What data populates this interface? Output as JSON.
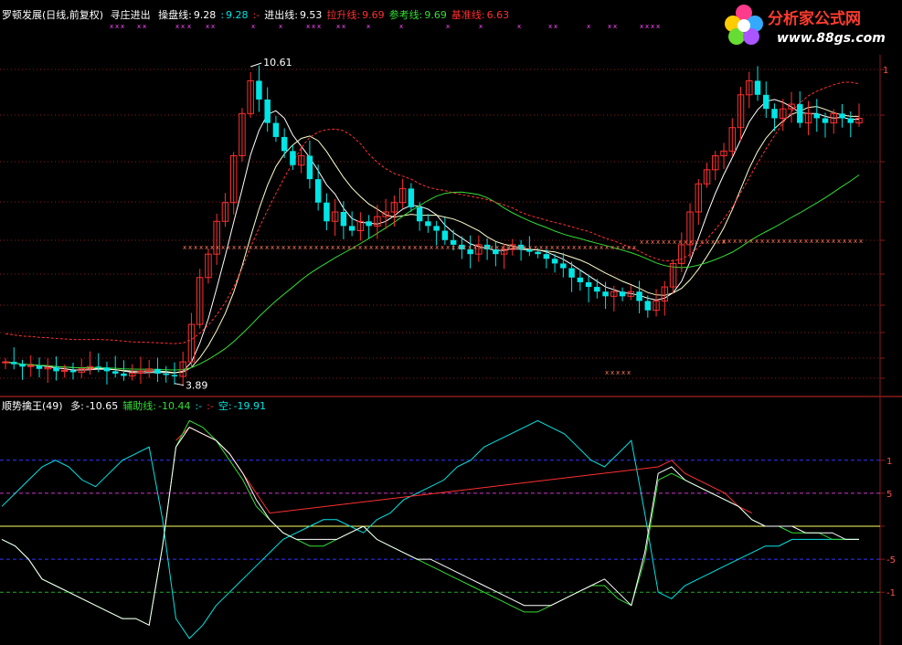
{
  "header_main": {
    "stock": "罗顿发展(日线,前复权)",
    "indicator": "寻庄进出",
    "items": [
      {
        "label": "操盘线:",
        "value": "9.28",
        "color": "#ffffff"
      },
      {
        "label": ":",
        "value": "9.28",
        "color": "#00e5e5"
      },
      {
        "label": ":-",
        "value": "",
        "color": "#ff3030"
      },
      {
        "label": "进出线:",
        "value": "9.53",
        "color": "#ffffff"
      },
      {
        "label": "拉升线:",
        "value": "9.69",
        "color": "#ff3030"
      },
      {
        "label": "参考线:",
        "value": "9.69",
        "color": "#33dd33"
      },
      {
        "label": "基准线:",
        "value": "6.63",
        "color": "#ff3030"
      }
    ]
  },
  "header_sub": {
    "indicator": "顺势擒王(49)",
    "items": [
      {
        "label": "多:",
        "value": "-10.65",
        "color": "#ffffff"
      },
      {
        "label": "辅助线:",
        "value": "-10.44",
        "color": "#33dd33"
      },
      {
        "label": ":-",
        "value": "",
        "color": "#00e5e5"
      },
      {
        "label": ":-",
        "value": "",
        "color": "#ff3030"
      },
      {
        "label": "空:",
        "value": "-19.91",
        "color": "#00e5e5"
      }
    ]
  },
  "logo": {
    "title": "分析家公式网",
    "url": "www.88gs.com"
  },
  "colors": {
    "up": "#ff3030",
    "down": "#00e5e5",
    "grid": "#8b1a1a",
    "yellow": "#ffff66",
    "green": "#33dd33",
    "magenta": "#ff44ff"
  },
  "chart_data": [
    {
      "type": "candlestick",
      "title": "罗顿发展(日线,前复权)",
      "annotations": [
        {
          "text": "10.61",
          "kind": "high"
        },
        {
          "text": "3.89",
          "kind": "low"
        }
      ],
      "y_ticks": [
        "1",
        "",
        "",
        "",
        "",
        "",
        "",
        "",
        ""
      ],
      "ylim": [
        3.5,
        11.3
      ],
      "close": [
        4.2,
        4.15,
        4.1,
        4.12,
        4.05,
        4.08,
        4.0,
        4.02,
        3.98,
        4.05,
        4.1,
        4.08,
        4.0,
        3.95,
        3.9,
        3.96,
        4.0,
        4.05,
        3.95,
        3.92,
        3.89,
        4.2,
        5.0,
        6.0,
        6.5,
        7.2,
        7.6,
        8.6,
        9.5,
        10.2,
        9.8,
        9.3,
        9.0,
        8.7,
        8.4,
        8.6,
        8.1,
        7.6,
        7.2,
        7.4,
        7.1,
        7.0,
        7.2,
        7.1,
        7.3,
        7.4,
        7.6,
        7.9,
        7.5,
        7.2,
        7.1,
        7.0,
        6.8,
        6.7,
        6.6,
        6.5,
        6.7,
        6.6,
        6.5,
        6.6,
        6.7,
        6.6,
        6.55,
        6.5,
        6.4,
        6.3,
        6.2,
        6.0,
        5.9,
        5.8,
        5.7,
        5.6,
        5.7,
        5.6,
        5.7,
        5.5,
        5.3,
        5.5,
        5.8,
        6.3,
        6.7,
        7.4,
        8.0,
        8.3,
        8.6,
        8.7,
        9.2,
        9.9,
        10.2,
        9.9,
        9.6,
        9.4,
        9.6,
        9.7,
        9.3,
        9.5,
        9.4,
        9.3,
        9.5,
        9.4,
        9.3,
        9.4
      ]
    },
    {
      "type": "line",
      "title": "顺势擒王(49)",
      "y_ticks": [
        "1",
        "5",
        "",
        "-5",
        "-1"
      ],
      "ylim": [
        -18,
        18
      ],
      "series": [
        {
          "name": "多",
          "color": "#ffffff",
          "values": [
            -2,
            -3,
            -5,
            -8,
            -9,
            -10,
            -11,
            -12,
            -13,
            -14,
            -14,
            -15,
            -3,
            12,
            15,
            14,
            13,
            11,
            8,
            4,
            1,
            -1,
            -2,
            -2,
            -2,
            -2,
            -1,
            0,
            -2,
            -3,
            -4,
            -5,
            -5,
            -6,
            -7,
            -8,
            -9,
            -10,
            -11,
            -12,
            -12,
            -12,
            -11,
            -10,
            -9,
            -8,
            -10,
            -12,
            -4,
            8,
            9,
            7,
            6,
            5,
            4,
            3,
            1,
            0,
            0,
            0,
            -1,
            -1,
            -1,
            -2,
            -2
          ]
        },
        {
          "name": "辅助线",
          "color": "#33dd33",
          "values": [
            -2,
            -3,
            -5,
            -8,
            -9,
            -10,
            -11,
            -12,
            -13,
            -14,
            -14,
            -15,
            -3,
            12,
            16,
            15,
            13,
            10,
            7,
            3,
            1,
            -1,
            -2,
            -3,
            -3,
            -2,
            -1,
            0,
            -2,
            -3,
            -4,
            -5,
            -6,
            -7,
            -8,
            -9,
            -10,
            -11,
            -12,
            -13,
            -13,
            -12,
            -11,
            -10,
            -9,
            -9,
            -11,
            -12,
            -5,
            7,
            8,
            7,
            6,
            5,
            4,
            3,
            1,
            0,
            0,
            -1,
            -1,
            -1,
            -2,
            -2,
            -2
          ]
        },
        {
          "name": "",
          "color": "#ff3030",
          "values": [
            null,
            null,
            null,
            null,
            null,
            null,
            null,
            null,
            null,
            null,
            null,
            null,
            null,
            13,
            15,
            14,
            13,
            11,
            8,
            5,
            2,
            null,
            null,
            null,
            null,
            null,
            null,
            null,
            null,
            null,
            null,
            null,
            null,
            null,
            null,
            null,
            null,
            null,
            null,
            null,
            null,
            null,
            null,
            null,
            null,
            null,
            null,
            null,
            null,
            9,
            10,
            8,
            7,
            6,
            5,
            3,
            2,
            null,
            null,
            null,
            null,
            null,
            null,
            null,
            null
          ]
        },
        {
          "name": "空",
          "color": "#00e5e5",
          "values": [
            3,
            5,
            7,
            9,
            10,
            9,
            7,
            6,
            8,
            10,
            11,
            12,
            1,
            -14,
            -17,
            -15,
            -12,
            -10,
            -8,
            -6,
            -4,
            -2,
            -1,
            0,
            1,
            1,
            0,
            -1,
            1,
            2,
            4,
            5,
            6,
            7,
            9,
            10,
            12,
            13,
            14,
            15,
            16,
            15,
            14,
            12,
            10,
            9,
            11,
            13,
            2,
            -10,
            -11,
            -9,
            -8,
            -7,
            -6,
            -5,
            -4,
            -3,
            -3,
            -2,
            -2,
            -2,
            -2,
            -2,
            -2
          ]
        }
      ],
      "reference_lines": [
        {
          "value": 10,
          "color": "#3333ff"
        },
        {
          "value": 5,
          "color": "#cc33cc"
        },
        {
          "value": 0,
          "color": "#ffff66"
        },
        {
          "value": -5,
          "color": "#3333ff"
        },
        {
          "value": -10,
          "color": "#22aa22"
        }
      ]
    }
  ]
}
